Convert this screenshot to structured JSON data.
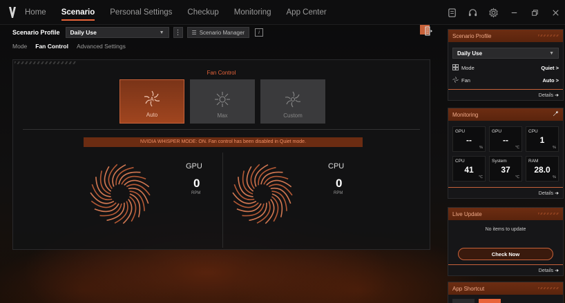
{
  "nav": {
    "items": [
      {
        "label": "Home",
        "active": false
      },
      {
        "label": "Scenario",
        "active": true
      },
      {
        "label": "Personal Settings",
        "active": false
      },
      {
        "label": "Checkup",
        "active": false
      },
      {
        "label": "Monitoring",
        "active": false
      },
      {
        "label": "App Center",
        "active": false
      }
    ],
    "window_controls": [
      "notes-icon",
      "headset-icon",
      "settings-gear-icon",
      "minimize-icon",
      "restore-icon",
      "close-icon"
    ]
  },
  "scenario_bar": {
    "label": "Scenario Profile",
    "selected_profile": "Daily Use",
    "manager_label": "Scenario Manager"
  },
  "subtabs": [
    {
      "label": "Mode",
      "active": false
    },
    {
      "label": "Fan Control",
      "active": true
    },
    {
      "label": "Advanced Settings",
      "active": false
    }
  ],
  "fan_panel": {
    "title": "Fan Control",
    "modes": [
      {
        "label": "Auto",
        "active": true,
        "icon": "fan-auto-icon"
      },
      {
        "label": "Max",
        "active": false,
        "icon": "fan-max-icon"
      },
      {
        "label": "Custom",
        "active": false,
        "icon": "fan-custom-icon"
      }
    ],
    "notice": "NVIDIA WHISPER MODE: ON. Fan control has been disabled in Quiet mode.",
    "fans": [
      {
        "name": "GPU",
        "rpm": "0",
        "unit": "RPM"
      },
      {
        "name": "CPU",
        "rpm": "0",
        "unit": "RPM"
      }
    ]
  },
  "sidebar": {
    "scenario_profile": {
      "title": "Scenario Profile",
      "selected": "Daily Use",
      "rows": [
        {
          "label": "Mode",
          "value": "Quiet >",
          "icon": "mode-grid-icon"
        },
        {
          "label": "Fan",
          "value": "Auto >",
          "icon": "fan-icon"
        }
      ],
      "details": "Details"
    },
    "monitoring": {
      "title": "Monitoring",
      "cells": [
        {
          "name": "GPU",
          "value": "--",
          "unit": "%"
        },
        {
          "name": "GPU",
          "value": "--",
          "unit": "℃"
        },
        {
          "name": "CPU",
          "value": "1",
          "unit": "%"
        },
        {
          "name": "CPU",
          "value": "41",
          "unit": "℃"
        },
        {
          "name": "System",
          "value": "37",
          "unit": "℃"
        },
        {
          "name": "RAM",
          "value": "28.0",
          "unit": "%"
        }
      ],
      "details": "Details"
    },
    "live_update": {
      "title": "Live Update",
      "status": "No items to update",
      "button": "Check Now",
      "details": "Details"
    },
    "app_shortcut": {
      "title": "App Shortcut"
    }
  },
  "colors": {
    "accent": "#e8643a",
    "header_bar": "#6d2d12",
    "notice_bg": "#6b2c12"
  }
}
